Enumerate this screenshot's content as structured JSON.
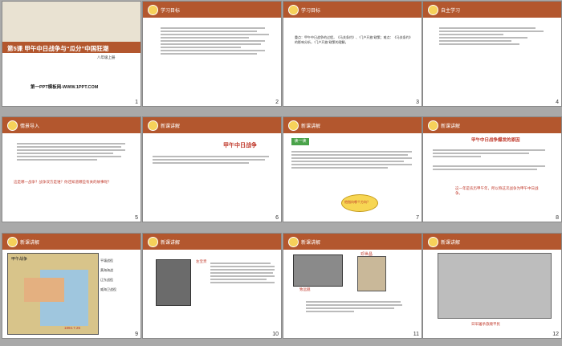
{
  "slides": {
    "s1": {
      "title": "第5课 甲午中日战争与“瓜分”中国狂潮",
      "subtitle": "八年级上册",
      "watermark": "第一PPT模板网-WWW.1PPT.COM",
      "num": "1"
    },
    "s2": {
      "header": "学习目标",
      "num": "2"
    },
    "s3": {
      "header": "学习目标",
      "body": "重点：甲午中日战争的过程，《马关条约》、“门户开放”政策；难点：《马关条约》的影响分析，“门户开放”政策的理解。",
      "num": "3"
    },
    "s4": {
      "header": "自主学习",
      "num": "4"
    },
    "s5": {
      "header": "情景导入",
      "question": "这是哪一战争？战争双方是谁？你还知道哪些有关的故事呢？",
      "num": "5"
    },
    "s6": {
      "header": "新课讲解",
      "title": "甲午中日战争",
      "num": "6"
    },
    "s7": {
      "header": "新课讲解",
      "tag": "读一读",
      "bubble": "他指向哪个方向？",
      "num": "7"
    },
    "s8": {
      "header": "新课讲解",
      "title": "甲午中日战争爆发的原因",
      "note": "这一年是农历甲午年，所以称这次战争为甲午中日战争。",
      "num": "8"
    },
    "s9": {
      "header": "新课讲解",
      "map_title": "甲午战争",
      "year": "1894.7.25",
      "labels": [
        "平壤战役",
        "黄海海战",
        "辽东战役",
        "威海卫战役"
      ],
      "num": "9"
    },
    "s10": {
      "header": "新课讲解",
      "name": "左宝贵",
      "num": "10"
    },
    "s11": {
      "header": "新课讲解",
      "person": "邓世昌",
      "ship": "致远舰",
      "num": "11"
    },
    "s12": {
      "header": "新课讲解",
      "caption": "日军屠杀旅顺平民",
      "num": "12"
    }
  },
  "colors": {
    "accent": "#b3572e",
    "red": "#c0392b",
    "badge": "#f6d15a"
  }
}
